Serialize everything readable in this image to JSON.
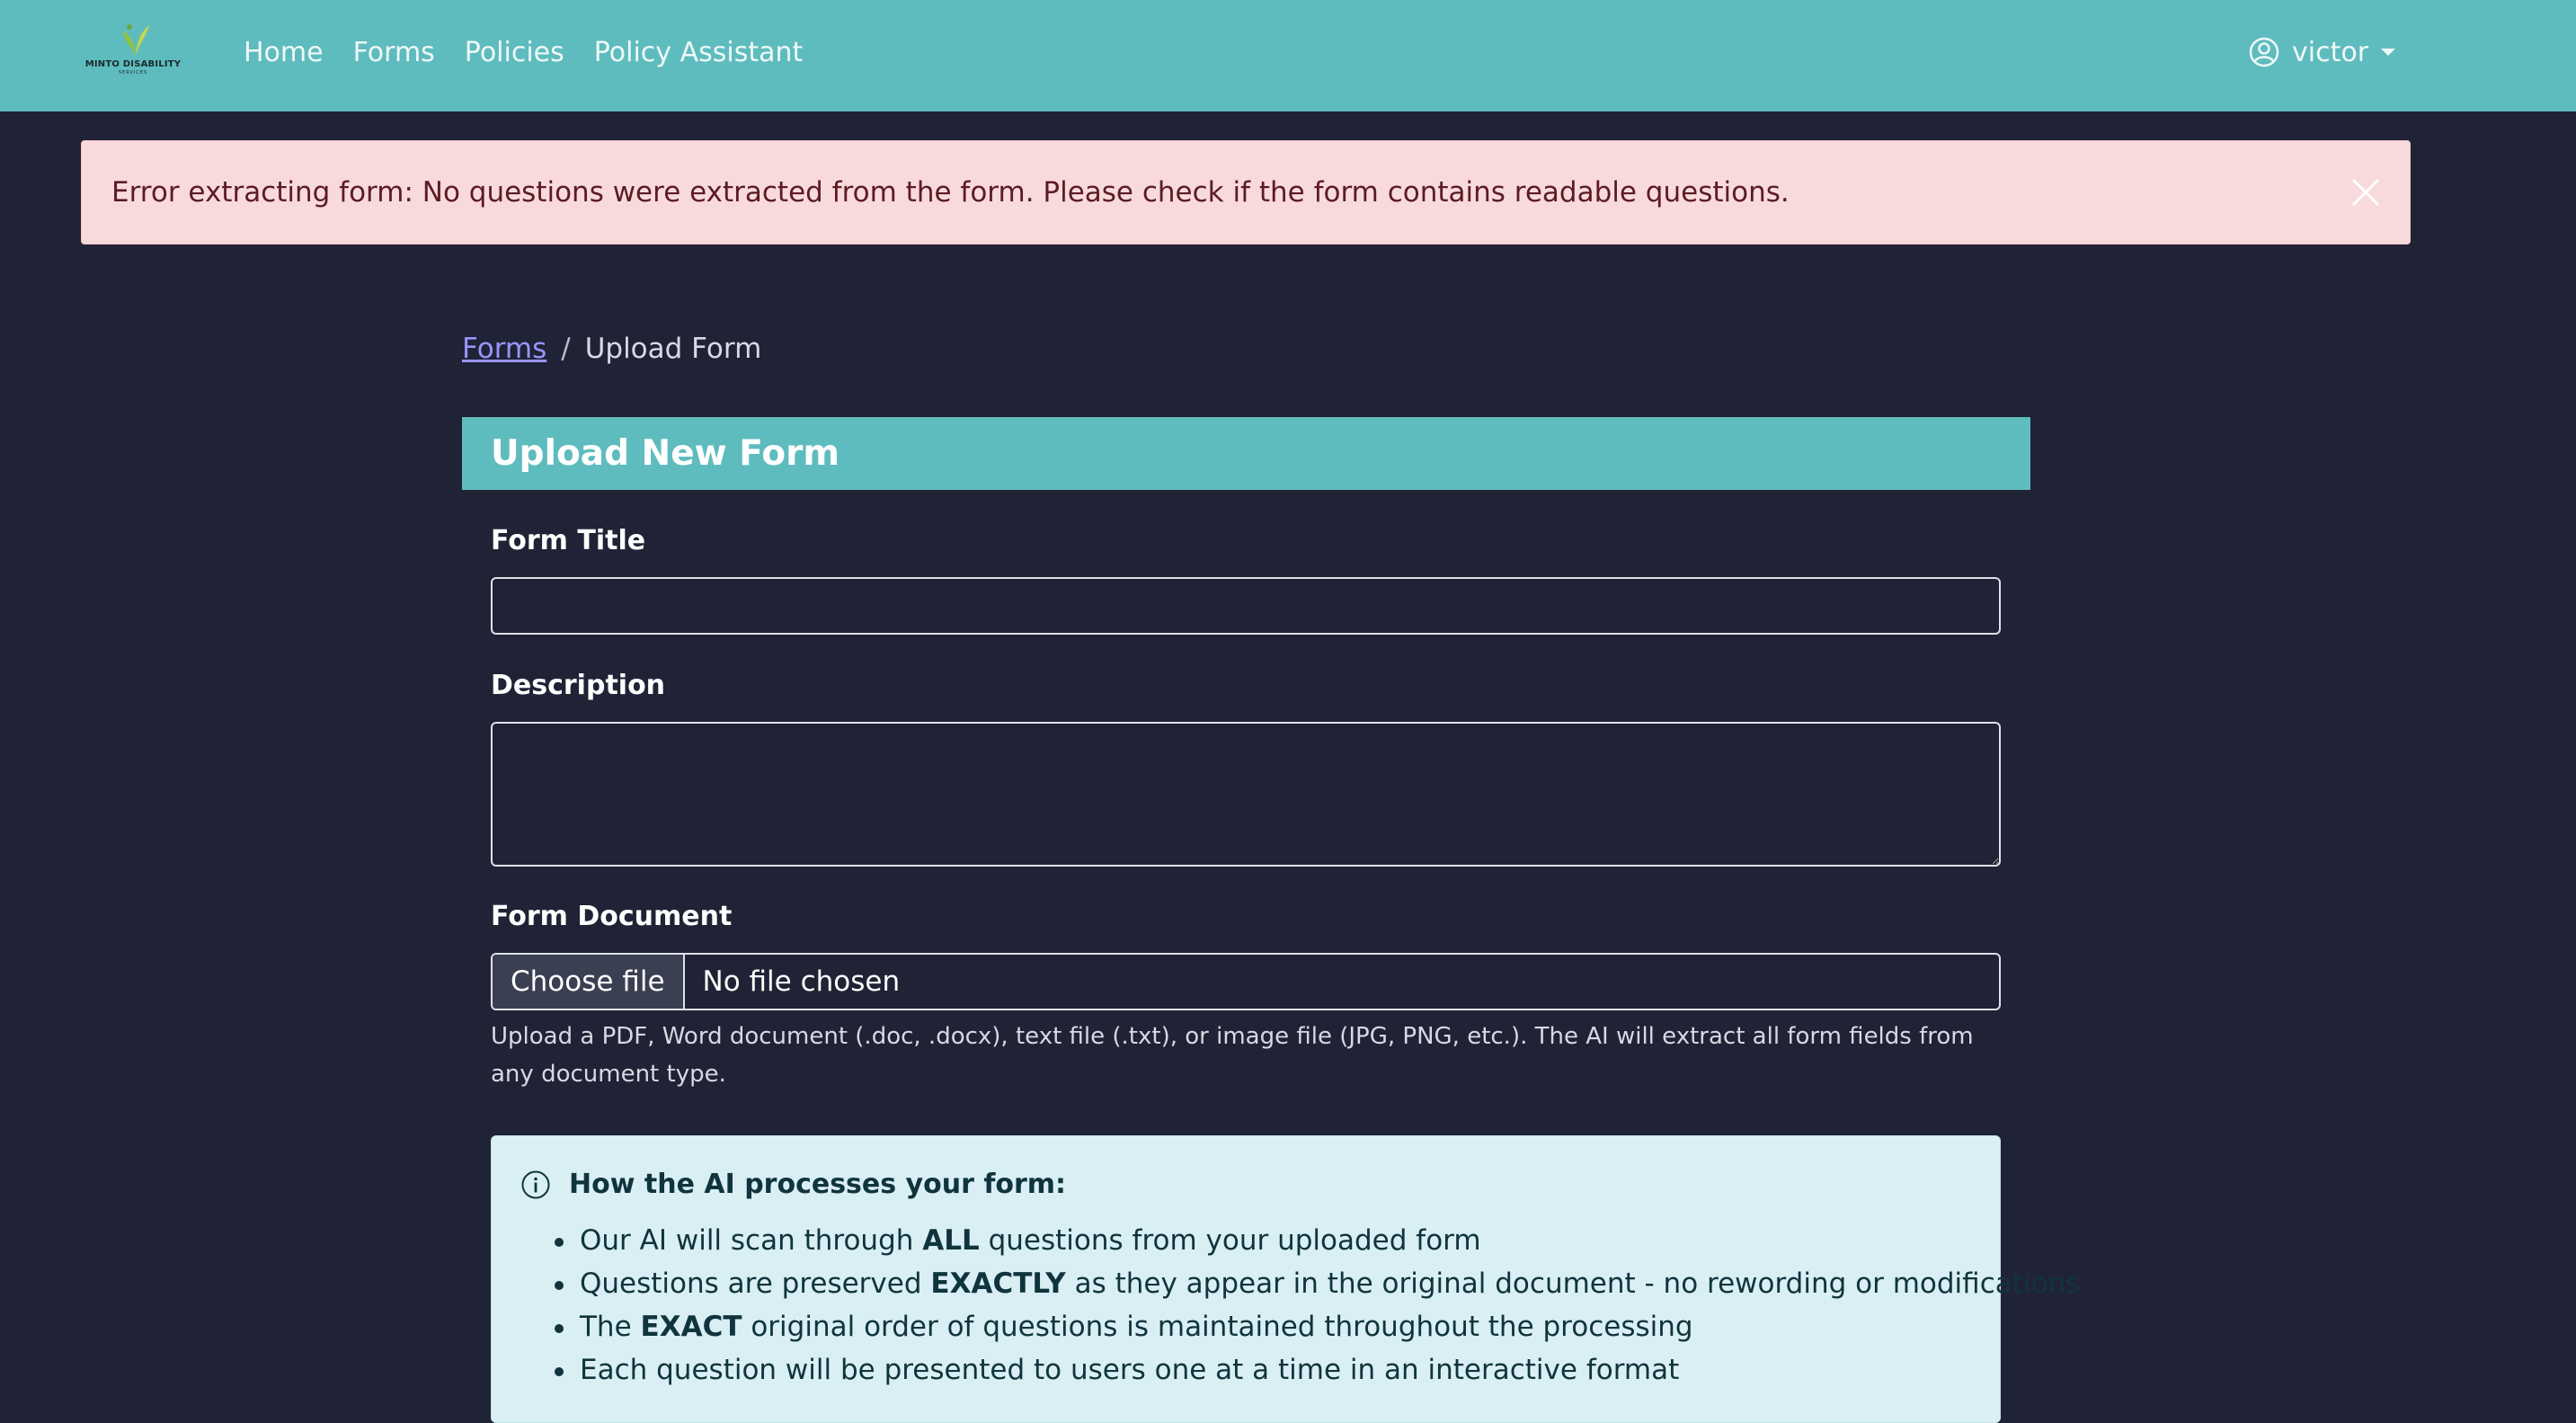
{
  "brand": {
    "name": "MINTO DISABILITY",
    "tagline": "SERVICES",
    "accent_color": "#5fbcbe"
  },
  "nav": {
    "links": [
      "Home",
      "Forms",
      "Policies",
      "Policy Assistant"
    ],
    "user": "victor",
    "user_icon": "user-circle-icon"
  },
  "alert": {
    "message": "Error extracting form: No questions were extracted from the form. Please check if the form contains readable questions.",
    "close_icon": "close-icon",
    "color": "#f8dadd"
  },
  "breadcrumb": {
    "parent": "Forms",
    "separator": "/",
    "current": "Upload Form"
  },
  "card": {
    "title": "Upload New Form"
  },
  "form": {
    "title_label": "Form Title",
    "title_value": "",
    "description_label": "Description",
    "description_value": "",
    "document_label": "Form Document",
    "file_button": "Choose file",
    "file_status": "No file chosen",
    "help_text": "Upload a PDF, Word document (.doc, .docx), text file (.txt), or image file (JPG, PNG, etc.). The AI will extract all form fields from any document type."
  },
  "info": {
    "heading": "How the AI processes your form:",
    "icon": "info-circle-icon",
    "items": [
      {
        "pre": "Our AI will scan through ",
        "bold": "ALL",
        "post": " questions from your uploaded form"
      },
      {
        "pre": "Questions are preserved ",
        "bold": "EXACTLY",
        "post": " as they appear in the original document - no rewording or modifications"
      },
      {
        "pre": "The ",
        "bold": "EXACT",
        "post": " original order of questions is maintained throughout the processing"
      },
      {
        "pre": "Each question will be presented to users one at a time in an interactive format",
        "bold": "",
        "post": ""
      }
    ]
  }
}
